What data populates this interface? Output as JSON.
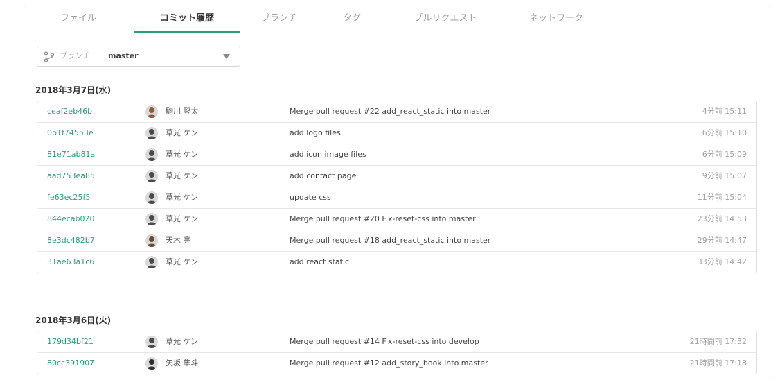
{
  "tabs": [
    {
      "label": "ファイル"
    },
    {
      "label": "コミット履歴"
    },
    {
      "label": "ブランチ"
    },
    {
      "label": "タグ"
    },
    {
      "label": "プルリクエスト"
    },
    {
      "label": "ネットワーク"
    }
  ],
  "active_tab": "コミット履歴",
  "branch": {
    "prefix": "ブランチ :",
    "name": "master",
    "icon": "branch-icon"
  },
  "groups": [
    {
      "date": "2018年3月7日(水)",
      "commits": [
        {
          "sha": "ceaf2eb46b",
          "author": "駒川 竪太",
          "message": "Merge pull request #22 add_react_static into master",
          "time": "4分前 15:11",
          "avatar_color": "#8a5a3c"
        },
        {
          "sha": "0b1f74553e",
          "author": "草光 ケン",
          "message": "add logo files",
          "time": "6分前 15:10",
          "avatar_color": "#4a4a4a"
        },
        {
          "sha": "81e71ab81a",
          "author": "草光 ケン",
          "message": "add icon image files",
          "time": "6分前 15:09",
          "avatar_color": "#4a4a4a"
        },
        {
          "sha": "aad753ea85",
          "author": "草光 ケン",
          "message": "add contact page",
          "time": "9分前 15:07",
          "avatar_color": "#4a4a4a"
        },
        {
          "sha": "fe63ec25f5",
          "author": "草光 ケン",
          "message": "update css",
          "time": "11分前 15:04",
          "avatar_color": "#4a4a4a"
        },
        {
          "sha": "844ecab020",
          "author": "草光 ケン",
          "message": "Merge pull request #20 Fix-reset-css into master",
          "time": "23分前 14:53",
          "avatar_color": "#4a4a4a"
        },
        {
          "sha": "8e3dc482b7",
          "author": "天木 亮",
          "message": "Merge pull request #18 add_react_static into master",
          "time": "29分前 14:47",
          "avatar_color": "#6b4a33"
        },
        {
          "sha": "31ae63a1c6",
          "author": "草光 ケン",
          "message": "add react static",
          "time": "33分前 14:42",
          "avatar_color": "#4a4a4a"
        }
      ]
    },
    {
      "date": "2018年3月6日(火)",
      "commits": [
        {
          "sha": "179d34bf21",
          "author": "草光 ケン",
          "message": "Merge pull request #14 Fix-reset-css into develop",
          "time": "21時間前 17:32",
          "avatar_color": "#4a4a4a"
        },
        {
          "sha": "80cc391907",
          "author": "矢坂 隼斗",
          "message": "Merge pull request #12 add_story_book into master",
          "time": "21時間前 17:18",
          "avatar_color": "#2e2e2e"
        }
      ]
    }
  ],
  "colors": {
    "accent": "#2f9a7f",
    "muted": "#a0a0a0",
    "border": "#dedede"
  }
}
